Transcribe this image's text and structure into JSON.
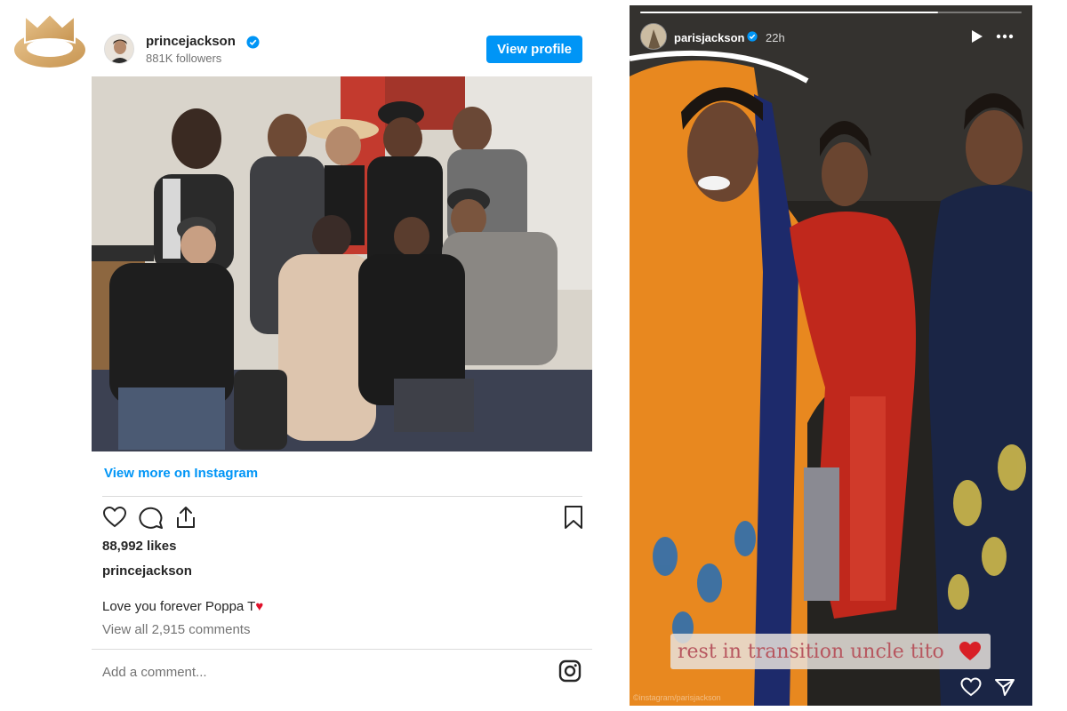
{
  "post": {
    "username": "princejackson",
    "followers": "881K followers",
    "view_profile": "View profile",
    "view_more": "View more on Instagram",
    "likes": "88,992 likes",
    "caption_user": "princejackson",
    "caption": "Love you forever Poppa T",
    "caption_emoji": "♥",
    "view_comments": "View all 2,915 comments",
    "add_comment_placeholder": "Add a comment...",
    "icons": [
      "heart-icon",
      "comment-icon",
      "share-icon",
      "bookmark-icon",
      "instagram-icon"
    ],
    "accent_color": "#0095f6"
  },
  "story": {
    "username": "parisjackson",
    "time": "22h",
    "progress": 0.78,
    "caption": "rest in transition uncle tito",
    "footer_text": "©instagram/parisjackson",
    "icons": [
      "play-icon",
      "more-icon",
      "heart-icon",
      "send-icon"
    ]
  },
  "site": {
    "logo": "site-logo"
  }
}
